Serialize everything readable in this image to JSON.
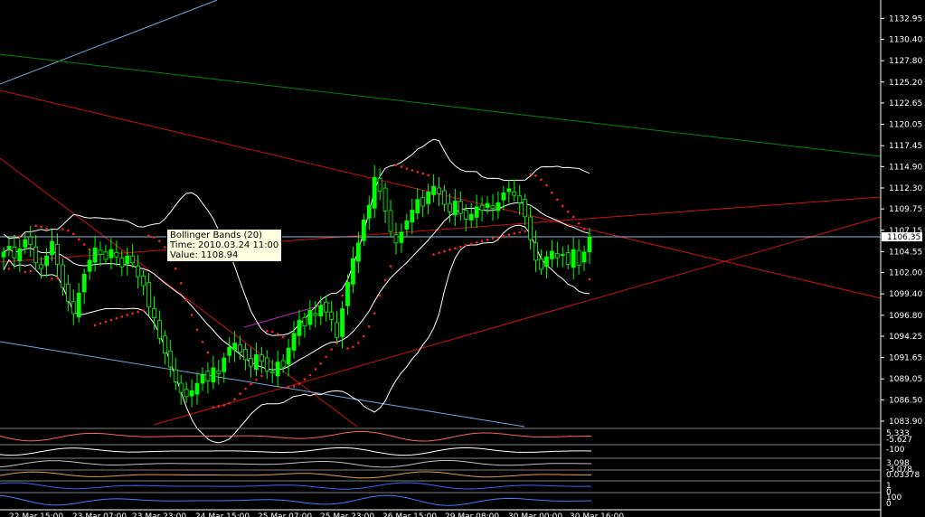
{
  "chart_data": {
    "type": "candlestick",
    "ylim": [
      1083.9,
      1134.2
    ],
    "y_ticks": [
      "1132.95",
      "1130.40",
      "1127.80",
      "1125.20",
      "1122.65",
      "1120.05",
      "1117.45",
      "1114.90",
      "1112.30",
      "1109.75",
      "1107.15",
      "1104.55",
      "1102.00",
      "1099.40",
      "1096.80",
      "1094.25",
      "1091.65",
      "1089.05",
      "1086.50",
      "1083.90"
    ],
    "current_price": "1106.35",
    "current_price_value": 1106.35,
    "x_tick_labels": [
      "22 Mar 15:00",
      "23 Mar 07:00",
      "23 Mar 23:00",
      "24 Mar 15:00",
      "25 Mar 07:00",
      "25 Mar 23:00",
      "26 Mar 15:00",
      "29 Mar 08:00",
      "30 Mar 00:00",
      "30 Mar 16:00"
    ],
    "close_series": [
      1104.5,
      1105.2,
      1103.8,
      1104.9,
      1106.0,
      1105.4,
      1103.2,
      1102.5,
      1104.0,
      1105.8,
      1103.0,
      1100.2,
      1098.5,
      1097.0,
      1099.5,
      1101.8,
      1103.5,
      1105.0,
      1104.2,
      1103.6,
      1104.8,
      1103.9,
      1102.7,
      1104.0,
      1103.2,
      1101.5,
      1100.4,
      1097.8,
      1096.5,
      1094.0,
      1092.2,
      1090.5,
      1088.7,
      1087.4,
      1086.9,
      1087.6,
      1088.5,
      1089.6,
      1088.8,
      1090.4,
      1089.7,
      1091.6,
      1092.9,
      1093.4,
      1092.3,
      1091.4,
      1090.6,
      1092.0,
      1091.2,
      1090.0,
      1089.8,
      1091.1,
      1090.5,
      1092.8,
      1094.6,
      1096.2,
      1095.5,
      1097.4,
      1096.8,
      1098.0,
      1097.2,
      1096.3,
      1094.1,
      1097.6,
      1100.8,
      1103.7,
      1105.6,
      1108.4,
      1110.2,
      1113.6,
      1111.9,
      1109.5,
      1107.0,
      1105.6,
      1106.9,
      1108.3,
      1109.6,
      1110.9,
      1110.1,
      1111.8,
      1112.5,
      1111.6,
      1110.3,
      1109.4,
      1110.7,
      1109.2,
      1108.5,
      1109.1,
      1110.0,
      1109.6,
      1110.4,
      1109.8,
      1110.5,
      1111.7,
      1112.2,
      1111.4,
      1110.5,
      1108.8,
      1106.0,
      1103.5,
      1102.4,
      1103.9,
      1104.6,
      1103.8,
      1104.2,
      1103.0,
      1104.8,
      1102.9,
      1104.5,
      1106.35
    ],
    "indicators": [
      {
        "name": "Bollinger Bands (20)",
        "period": 20,
        "color": "#ffffff"
      },
      {
        "name": "Parabolic SAR",
        "color": "#ff2020"
      }
    ],
    "tooltip": {
      "title": "Bollinger Bands (20)",
      "time_label": "Time:",
      "time": "2010.03.24 11:00",
      "value_label": "Value:",
      "value": "1108.94"
    },
    "sub_panels": [
      {
        "name": "histogram",
        "labels": [
          "5.333",
          "-5.627"
        ]
      },
      {
        "name": "oscillator-1",
        "labels": [
          "-100"
        ]
      },
      {
        "name": "oscillator-2",
        "labels": [
          "3.098",
          "-3.078"
        ]
      },
      {
        "name": "oscillator-3",
        "labels": [
          "0.03378"
        ]
      },
      {
        "name": "signal-lines",
        "labels": [
          "1",
          "0"
        ]
      },
      {
        "name": "oscillator-4",
        "labels": [
          "100",
          "0"
        ]
      }
    ]
  },
  "colors": {
    "background": "#000000",
    "bull_candle": "#00ff00",
    "bear_candle": "#000000",
    "bollinger": "#ffffff",
    "sar": "#ff2020",
    "trend_red": "#d01010",
    "trend_green": "#008800",
    "trend_blue": "#6fa8dc",
    "price_line": "#8fb7e0",
    "axis": "#ffffff"
  }
}
